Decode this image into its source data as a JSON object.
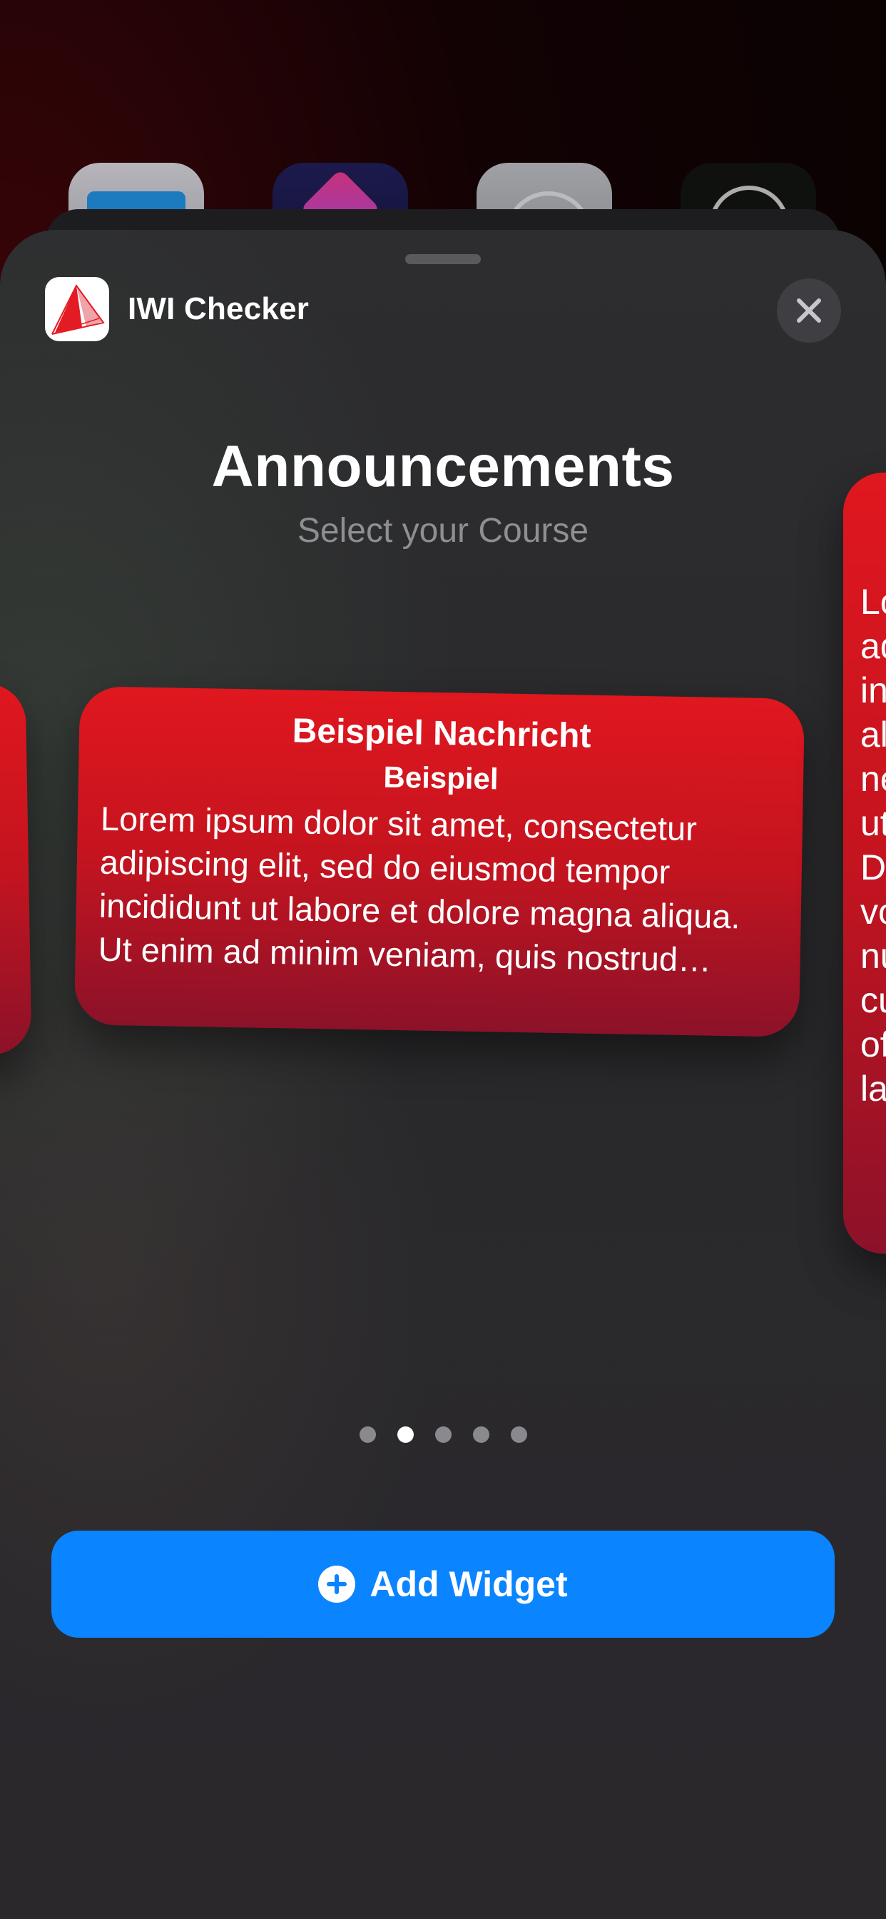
{
  "app": {
    "name": "IWI Checker",
    "icon": "sailboat-logo-icon"
  },
  "header": {
    "close_icon": "close-icon"
  },
  "widget_gallery": {
    "title": "Announcements",
    "subtitle": "Select your Course"
  },
  "widget": {
    "title": "Beispiel Nachricht",
    "subtitle": "Beispiel",
    "body": "Lorem ipsum dolor sit amet, consectetur adipiscing elit, sed do eiusmod tempor incididunt ut labore et dolore magna aliqua. Ut enim ad minim veniam, quis nostrud exercitation ullamco laboris nisi ut aliquip ex ea commodo consequat."
  },
  "right_widget": {
    "lines": [
      "Lo",
      "ad",
      "in",
      "al",
      "ne",
      "ut",
      "D",
      "vo",
      "nu",
      "cu",
      "of",
      "la"
    ]
  },
  "pagination": {
    "count": 5,
    "active_index": 1
  },
  "add_button": {
    "label": "Add Widget",
    "icon": "plus-circle-icon"
  },
  "colors": {
    "accent": "#0a84ff",
    "widget_red": "#e0171f",
    "widget_dark_red": "#8c1229",
    "sheet_bg": "#2c2c2e"
  }
}
